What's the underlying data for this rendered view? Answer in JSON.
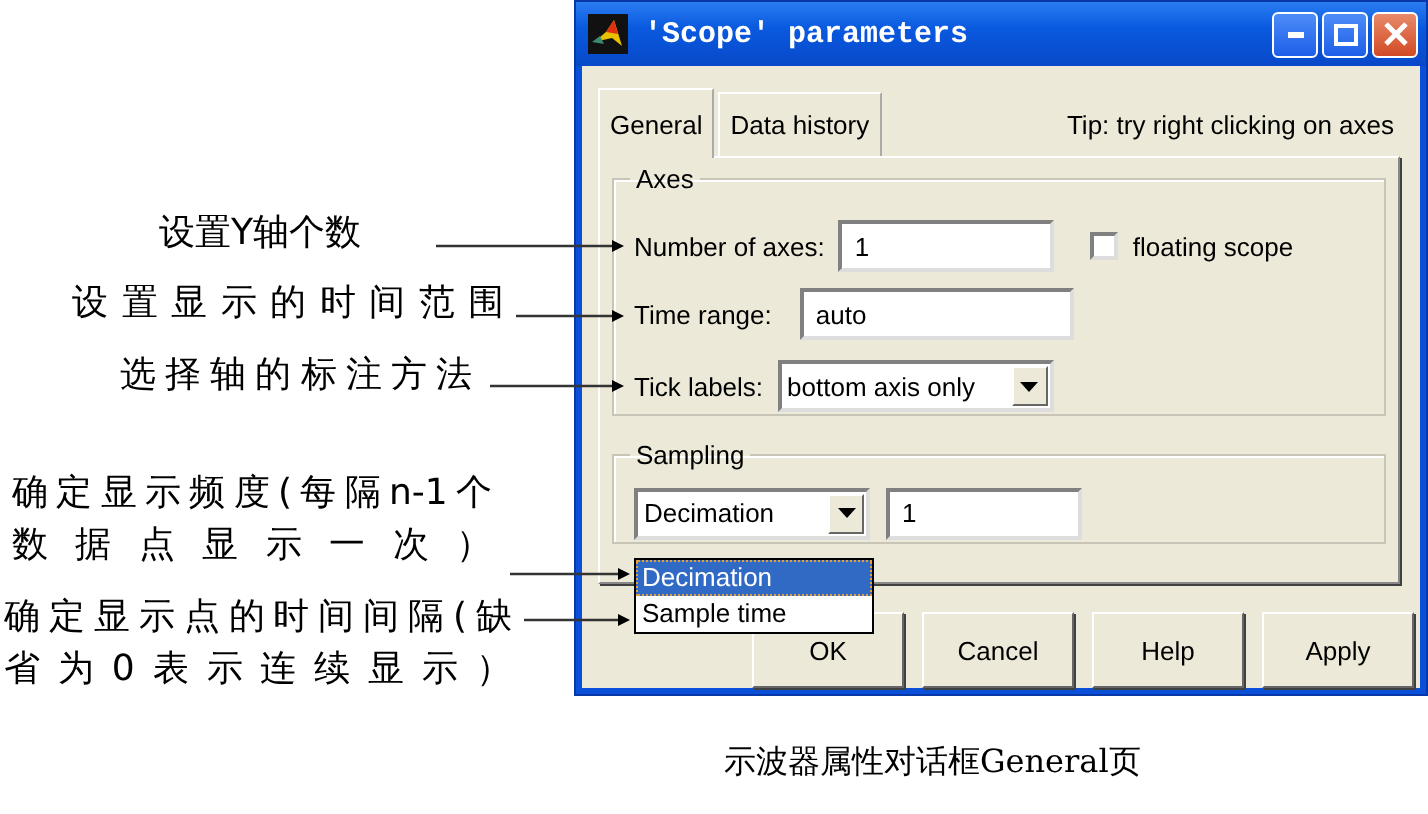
{
  "annotations": [
    {
      "lines": [
        "设置Y轴个数"
      ]
    },
    {
      "lines": [
        "设置显示的时间范围"
      ]
    },
    {
      "lines": [
        "选择轴的标注方法"
      ]
    },
    {
      "lines": [
        "确定显示频度(每隔n-1个",
        "数据点显示一次）"
      ]
    },
    {
      "lines": [
        "确定显示点的时间间隔(缺",
        "省为0表示连续显示）"
      ]
    }
  ],
  "window": {
    "title": "'Scope' parameters"
  },
  "tabs": [
    {
      "label": "General",
      "selected": true
    },
    {
      "label": "Data history",
      "selected": false
    }
  ],
  "tip": "Tip: try right clicking on axes",
  "axes_group": {
    "title": "Axes",
    "number_of_axes": {
      "label": "Number of axes:",
      "value": "1"
    },
    "floating_scope": {
      "label": "floating scope",
      "checked": false
    },
    "time_range": {
      "label": "Time range:",
      "value": "auto"
    },
    "tick_labels": {
      "label": "Tick labels:",
      "value": "bottom axis only"
    }
  },
  "sampling_group": {
    "title": "Sampling",
    "mode": {
      "value": "Decimation",
      "expanded": true,
      "options": [
        {
          "label": "Decimation",
          "selected": true
        },
        {
          "label": "Sample time",
          "selected": false
        }
      ]
    },
    "value": "1"
  },
  "buttons": [
    "OK",
    "Cancel",
    "Help",
    "Apply"
  ],
  "caption": "示波器属性对话框General页"
}
